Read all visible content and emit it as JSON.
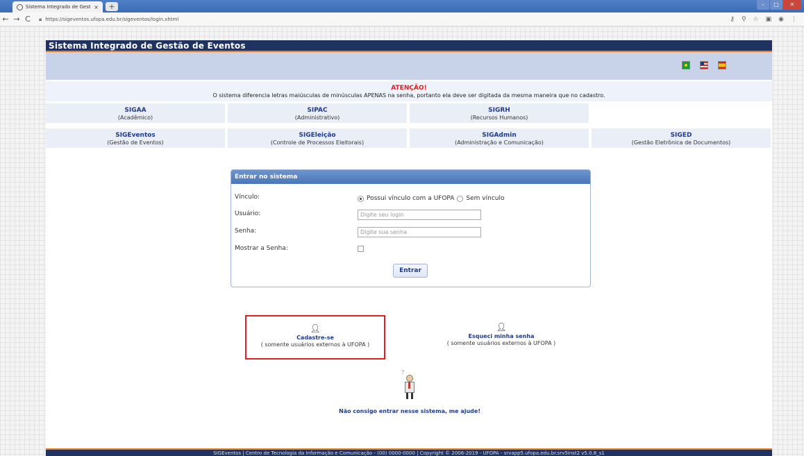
{
  "browser": {
    "tab_title": "Sistema Integrado de Gestão de",
    "tab_close": "×",
    "new_tab": "+",
    "url": "https://sigeventos.ufopa.edu.br/sigeventos/login.xhtml",
    "back": "←",
    "forward": "→",
    "reload": "C"
  },
  "header": {
    "title": "Sistema Integrado de Gestão de Eventos"
  },
  "languages": [
    "pt-BR",
    "en-US",
    "es-ES"
  ],
  "warning": {
    "title": "ATENÇÃO!",
    "text": "O sistema diferencia letras maiúsculas de minúsculas APENAS na senha, portanto ela deve ser digitada da mesma maneira que no cadastro."
  },
  "systems_row1": [
    {
      "name": "SIGAA",
      "desc": "(Acadêmico)"
    },
    {
      "name": "SIPAC",
      "desc": "(Administrativo)"
    },
    {
      "name": "SIGRH",
      "desc": "(Recursos Humanos)"
    }
  ],
  "systems_row2": [
    {
      "name": "SIGEventos",
      "desc": "(Gestão de Eventos)"
    },
    {
      "name": "SIGEleição",
      "desc": "(Controle de Processos Eleitorais)"
    },
    {
      "name": "SIGAdmin",
      "desc": "(Administração e Comunicação)"
    },
    {
      "name": "SIGED",
      "desc": "(Gestão Eletrônica de Documentos)"
    }
  ],
  "login": {
    "heading": "Entrar no sistema",
    "vinculo_label": "Vínculo:",
    "vinculo_option1": "Possui vínculo com a UFOPA",
    "vinculo_option2": "Sem vínculo",
    "vinculo_selected": "Possui vínculo com a UFOPA",
    "usuario_label": "Usuário:",
    "usuario_placeholder": "Digite seu login",
    "senha_label": "Senha:",
    "senha_placeholder": "Digite sua senha",
    "mostrar_label": "Mostrar a Senha:",
    "submit": "Entrar"
  },
  "links": {
    "cadastre_title": "Cadastre-se",
    "cadastre_sub": "( somente usuários externos à UFOPA )",
    "esqueci_title": "Esqueci minha senha",
    "esqueci_sub": "( somente usuários externos à UFOPA )",
    "help": "Não consigo entrar nesse sistema, me ajude!"
  },
  "footer": {
    "text": "SIGEventos | Centro de Tecnologia da Informação e Comunicação - (00) 0000-0000 | Copyright © 2006-2019 - UFOPA - srvapp5.ufopa.edu.br.srv5inst2 v5.0.8_s1"
  },
  "colors": {
    "header_bg": "#1f3260",
    "accent_orange": "#e67e22",
    "link_blue": "#1f3a8f",
    "warning_red": "#e01a1a",
    "highlight_red": "#e02020"
  }
}
